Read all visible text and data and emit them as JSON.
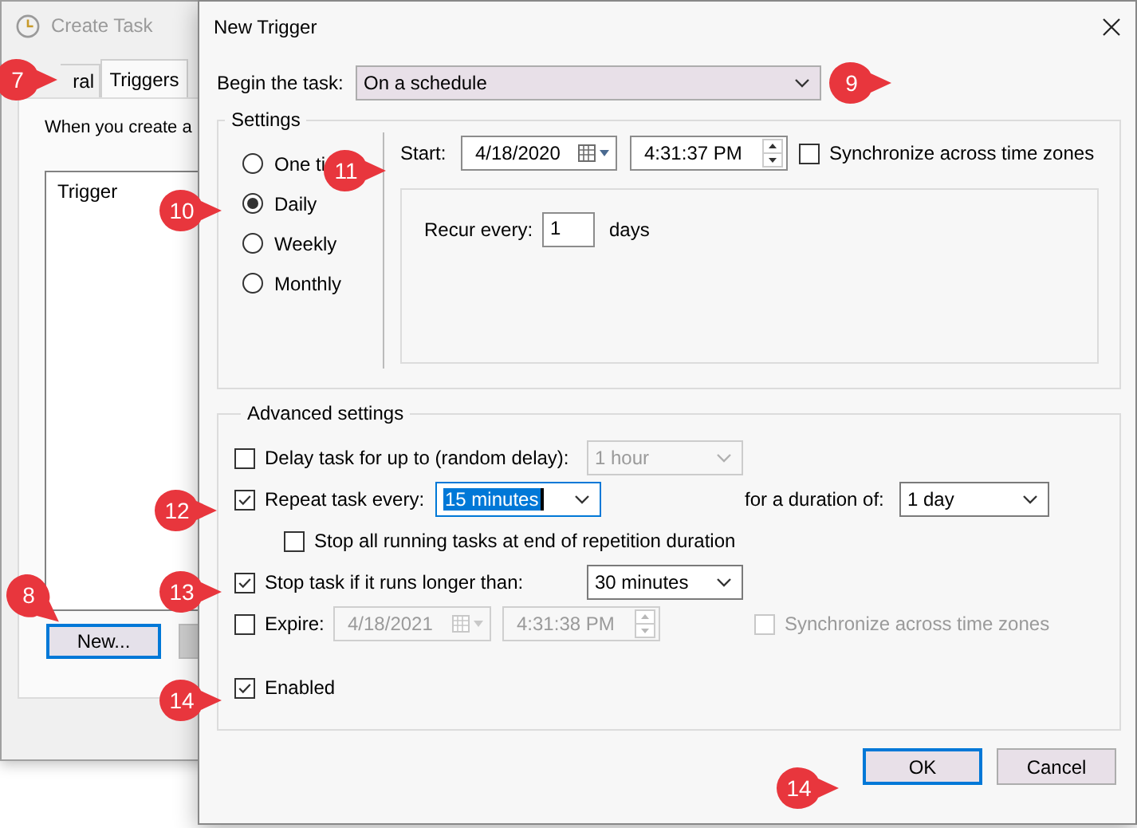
{
  "background_window": {
    "title": "Create Task",
    "tabs": [
      {
        "label": "ral",
        "selected": false
      },
      {
        "label": "Triggers",
        "selected": true
      }
    ],
    "description": "When you create a",
    "list": {
      "columns": [
        "Trigger"
      ]
    },
    "buttons": [
      {
        "label": "New...",
        "focused": true
      }
    ]
  },
  "dialog": {
    "title": "New Trigger",
    "begin_task": {
      "label": "Begin the task:",
      "value": "On a schedule"
    },
    "settings": {
      "title": "Settings",
      "schedule_options": [
        {
          "label": "One ti",
          "selected": false
        },
        {
          "label": "Daily",
          "selected": true
        },
        {
          "label": "Weekly",
          "selected": false
        },
        {
          "label": "Monthly",
          "selected": false
        }
      ],
      "start": {
        "label": "Start:",
        "date": "4/18/2020",
        "time": "4:31:37 PM"
      },
      "sync": {
        "label": "Synchronize across time zones",
        "checked": false
      },
      "recur": {
        "label": "Recur every:",
        "value": "1",
        "unit": "days"
      }
    },
    "advanced": {
      "title": "Advanced settings",
      "delay": {
        "label": "Delay task for up to (random delay):",
        "checked": false,
        "value": "1 hour",
        "disabled": true
      },
      "repeat": {
        "label": "Repeat task every:",
        "checked": true,
        "value": "15 minutes",
        "duration_label": "for a duration of:",
        "duration": "1 day"
      },
      "stop_all": {
        "label": "Stop all running tasks at end of repetition duration",
        "checked": false
      },
      "stop_task": {
        "label": "Stop task if it runs longer than:",
        "checked": true,
        "value": "30 minutes"
      },
      "expire": {
        "label": "Expire:",
        "checked": false,
        "date": "4/18/2021",
        "time": "4:31:38 PM",
        "disabled": true,
        "sync_label": "Synchronize across time zones",
        "sync_checked": false
      },
      "enabled": {
        "label": "Enabled",
        "checked": true
      }
    },
    "buttons": [
      {
        "label": "OK",
        "default": true
      },
      {
        "label": "Cancel",
        "default": false
      }
    ]
  },
  "callouts": [
    {
      "number": "7"
    },
    {
      "number": "8"
    },
    {
      "number": "9"
    },
    {
      "number": "10"
    },
    {
      "number": "11"
    },
    {
      "number": "12"
    },
    {
      "number": "13"
    },
    {
      "number": "14"
    },
    {
      "number": "14"
    }
  ]
}
